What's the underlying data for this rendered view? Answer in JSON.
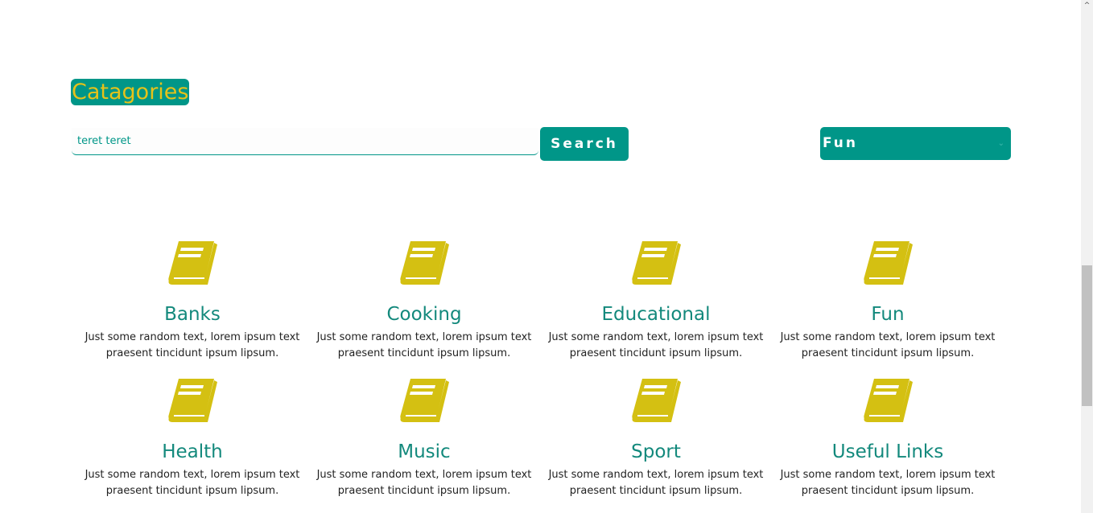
{
  "page": {
    "title": "Catagories"
  },
  "search": {
    "value": "teret teret",
    "button_label": "Search"
  },
  "filter": {
    "selected": "Fun",
    "chevron": "⌄"
  },
  "categories": [
    {
      "name": "Banks",
      "description": "Just some random text, lorem ipsum text praesent tincidunt ipsum lipsum."
    },
    {
      "name": "Cooking",
      "description": "Just some random text, lorem ipsum text praesent tincidunt ipsum lipsum."
    },
    {
      "name": "Educational",
      "description": "Just some random text, lorem ipsum text praesent tincidunt ipsum lipsum."
    },
    {
      "name": "Fun",
      "description": "Just some random text, lorem ipsum text praesent tincidunt ipsum lipsum."
    },
    {
      "name": "Health",
      "description": "Just some random text, lorem ipsum text praesent tincidunt ipsum lipsum."
    },
    {
      "name": "Music",
      "description": "Just some random text, lorem ipsum text praesent tincidunt ipsum lipsum."
    },
    {
      "name": "Sport",
      "description": "Just some random text, lorem ipsum text praesent tincidunt ipsum lipsum."
    },
    {
      "name": "Useful Links",
      "description": "Just some random text, lorem ipsum text praesent tincidunt ipsum lipsum."
    }
  ],
  "icons": {
    "category_icon": "book-icon"
  },
  "colors": {
    "accent": "#009688",
    "title_text": "#e6c219",
    "icon": "#d4c012",
    "category_name": "#13897c"
  },
  "scrollbar": {
    "up_arrow": "^"
  }
}
